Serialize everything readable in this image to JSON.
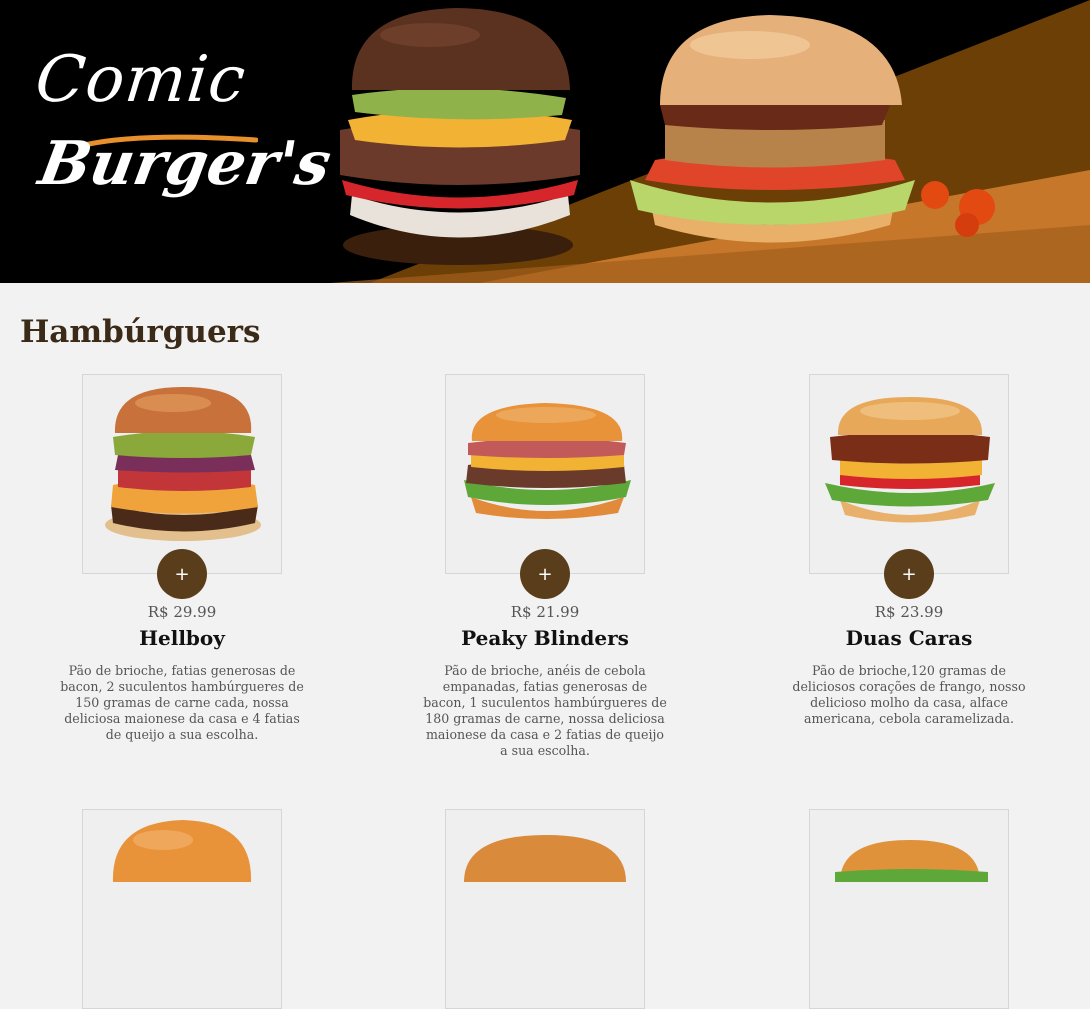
{
  "brand": {
    "logo_line1": "Comic",
    "logo_line2": "Burger's",
    "accent_color": "#5a3e1b",
    "highlight_color": "#e8902c"
  },
  "section": {
    "title": "Hambúrguers"
  },
  "add_button_label": "+",
  "products": [
    {
      "name": "Hellboy",
      "price": "R$ 29.99",
      "description": "Pão de brioche, fatias generosas de bacon, 2 suculentos hambúrgueres de 150 gramas de carne cada, nossa deliciosa maionese da casa e 4 fatias de queijo a sua escolha."
    },
    {
      "name": "Peaky Blinders",
      "price": "R$ 21.99",
      "description": "Pão de brioche, anéis de cebola empanadas, fatias generosas de bacon, 1 suculentos hambúrgueres de 180 gramas de carne, nossa deliciosa maionese da casa e 2 fatias de queijo a sua escolha."
    },
    {
      "name": "Duas Caras",
      "price": "R$ 23.99",
      "description": "Pão de brioche,120 gramas de deliciosos corações de frango, nosso delicioso molho da casa, alface americana, cebola caramelizada."
    }
  ]
}
